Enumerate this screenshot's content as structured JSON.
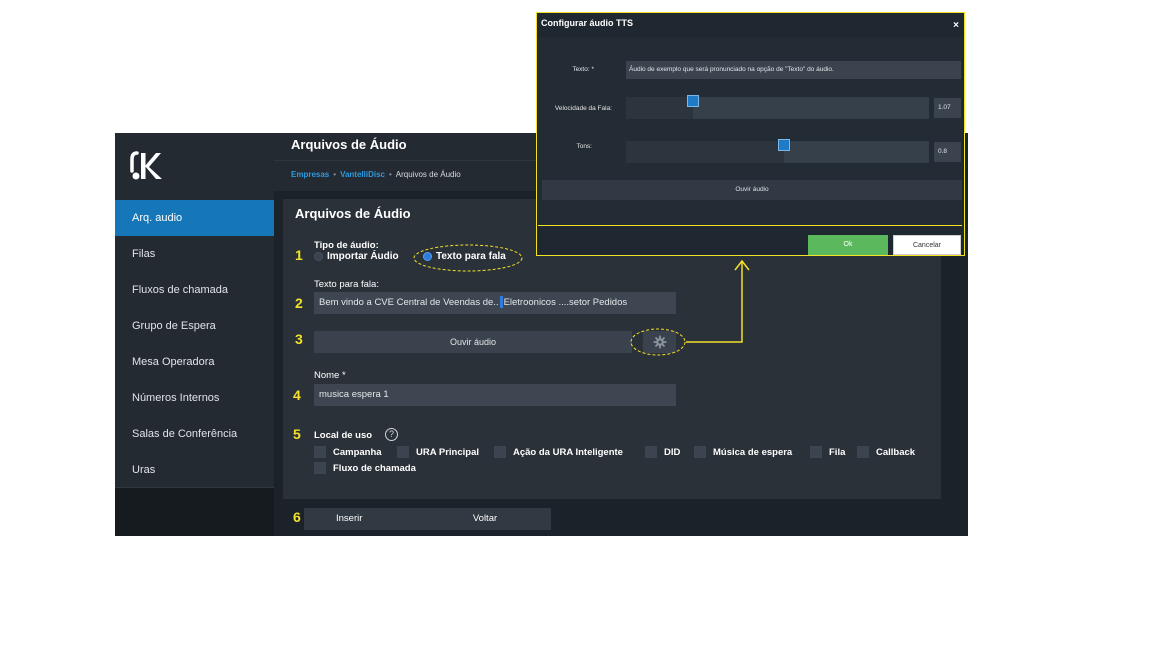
{
  "sidebar": {
    "items": [
      {
        "label": "Arq. audio",
        "active": true
      },
      {
        "label": "Filas"
      },
      {
        "label": "Fluxos de chamada"
      },
      {
        "label": "Grupo de Espera"
      },
      {
        "label": "Mesa Operadora"
      },
      {
        "label": "Números Internos"
      },
      {
        "label": "Salas de Conferência"
      },
      {
        "label": "Uras"
      }
    ]
  },
  "header": {
    "title": "Arquivos de Áudio",
    "breadcrumb": [
      "Empresas",
      "VantelliDisc",
      "Arquivos de Áudio"
    ]
  },
  "form": {
    "title": "Arquivos de Áudio",
    "tipo_label": "Tipo de áudio:",
    "tipo_options": [
      "Importar Áudio",
      "Texto para fala"
    ],
    "tipo_selected": "Texto para fala",
    "texto_label": "Texto para fala:",
    "texto_value_a": "Bem vindo a CVE Central de Veendas de..",
    "texto_value_b": "Eletroonicos ....setor  Pedidos",
    "ouvir_label": "Ouvir áudio",
    "nome_label": "Nome *",
    "nome_value": "musica espera 1",
    "local_label": "Local de uso",
    "local_options": [
      "Campanha",
      "URA Principal",
      "Ação da URA Inteligente",
      "DID",
      "Música de espera",
      "Fila",
      "Callback",
      "Fluxo de chamada"
    ]
  },
  "actions": {
    "insert_label": "Inserir",
    "back_label": "Voltar"
  },
  "steps": [
    "1",
    "2",
    "3",
    "4",
    "5",
    "6"
  ],
  "modal": {
    "title": "Configurar áudio TTS",
    "close": "×",
    "texto_label": "Texto: *",
    "texto_value": "Áudio de exemplo que será pronunciado na opção de \"Texto\" do áudio.",
    "velocidade_label": "Velocidade da Fala:",
    "velocidade_value": "1.07",
    "velocidade_fraction": 0.22,
    "tons_label": "Tons:",
    "tons_value": "0.8",
    "tons_fraction": 0.52,
    "ouvir_label": "Ouvir áudio",
    "ok_label": "Ok",
    "cancel_label": "Cancelar"
  },
  "colors": {
    "accent": "#1677b8",
    "annotation": "#f3e12b",
    "ok": "#5cb85c",
    "background": "#1b2229"
  },
  "icons": {
    "logo": "k-headset-logo",
    "gear": "gear-icon",
    "help": "question-circle-icon",
    "close": "close-icon"
  }
}
